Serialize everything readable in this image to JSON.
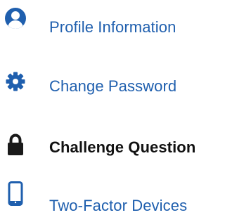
{
  "menu": {
    "items": [
      {
        "label": "Profile Information",
        "icon": "user-circle-icon",
        "active": false
      },
      {
        "label": "Change Password",
        "icon": "gear-icon",
        "active": false
      },
      {
        "label": "Challenge Question",
        "icon": "lock-icon",
        "active": true
      },
      {
        "label": "Two-Factor Devices",
        "icon": "mobile-phone-icon",
        "active": false
      }
    ]
  },
  "colors": {
    "link": "#1f5fae",
    "active_text": "#111111",
    "active_icon": "#1a1a1a"
  }
}
